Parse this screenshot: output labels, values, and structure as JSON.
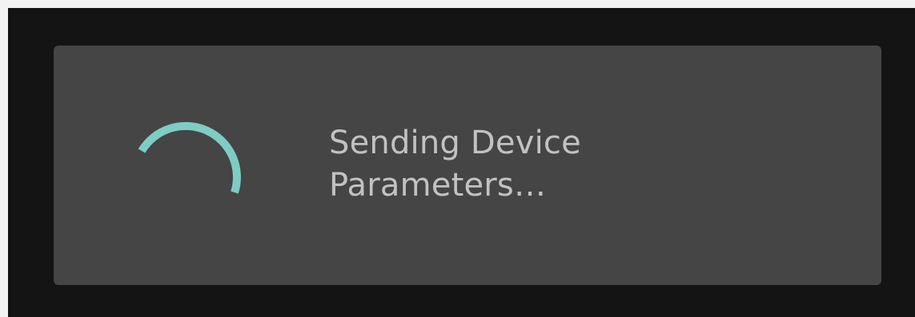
{
  "dialog": {
    "message_line1": "Sending Device",
    "message_line2": "Parameters…",
    "spinner_icon": "progress-spinner-icon",
    "accent_color": "#7dcdc4",
    "background_color": "#454545",
    "text_color": "#c2c2c2"
  },
  "screen": {
    "background_color": "#141414"
  }
}
